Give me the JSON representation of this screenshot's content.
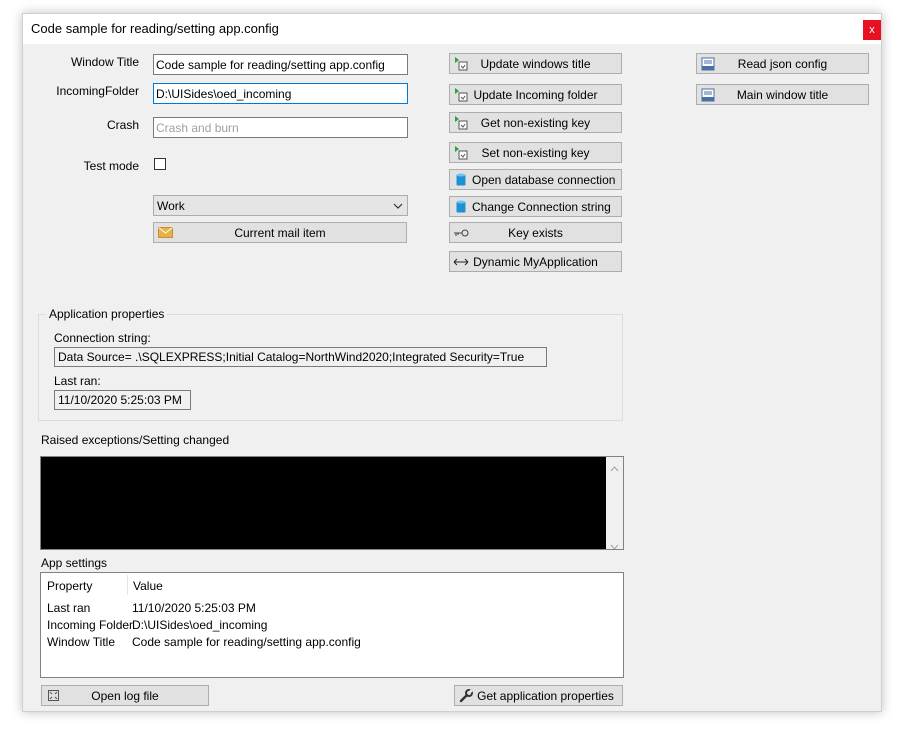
{
  "window": {
    "title": "Code sample for reading/setting app.config",
    "close_label": "x"
  },
  "form": {
    "window_title_label": "Window Title",
    "window_title_value": "Code sample for reading/setting app.config",
    "incoming_label": "IncomingFolder",
    "incoming_value": "D:\\UISides\\oed_incoming",
    "crash_label": "Crash",
    "crash_placeholder": "Crash and burn",
    "test_mode_label": "Test mode",
    "test_mode_checked": false,
    "combo_value": "Work",
    "current_mail_label": "Current mail item"
  },
  "buttons": {
    "update_windows_title": "Update windows title",
    "update_incoming_folder": "Update Incoming folder",
    "get_nonexisting_key_1": "Get non-existing key",
    "set_nonexisting_key": "Set non-existing key",
    "open_db_connection": "Open database connection",
    "change_connection_string": "Change Connection string",
    "key_exists": "Key exists",
    "dynamic_myapplication": "Dynamic MyApplication",
    "read_json_config": "Read json config",
    "main_window_title": "Main window title",
    "open_log_file": "Open log file",
    "get_application_properties": "Get application properties"
  },
  "app_properties": {
    "group_title": "Application properties",
    "connection_label": "Connection string:",
    "connection_value": "Data Source= .\\SQLEXPRESS;Initial Catalog=NorthWind2020;Integrated Security=True",
    "last_ran_label": "Last ran:",
    "last_ran_value": "11/10/2020 5:25:03 PM"
  },
  "exceptions": {
    "label": "Raised exceptions/Setting changed"
  },
  "app_settings": {
    "label": "App settings",
    "columns": [
      "Property",
      "Value"
    ],
    "rows": [
      [
        "Last ran",
        "11/10/2020 5:25:03 PM"
      ],
      [
        "Incoming Folder",
        "D:\\UISides\\oed_incoming"
      ],
      [
        "Window Title",
        "Code sample for reading/setting app.config"
      ]
    ]
  },
  "colors": {
    "close": "#e81123",
    "accent": "#0078d7",
    "db_icon": "#1e90d6",
    "mail_icon": "#e8b14a"
  }
}
